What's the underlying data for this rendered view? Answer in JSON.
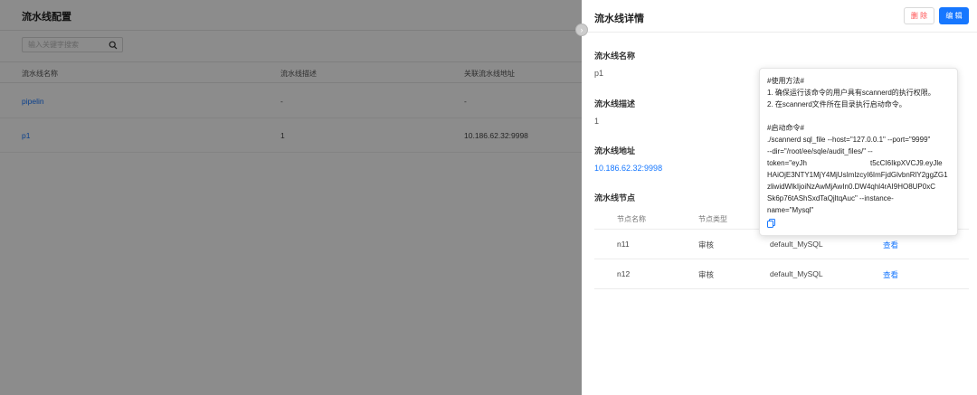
{
  "list_page": {
    "title": "流水线配置",
    "search_placeholder": "输入关键字搜索",
    "columns": [
      "流水线名称",
      "流水线描述",
      "关联流水线地址"
    ],
    "rows": [
      {
        "name": "pipelin",
        "description": "-",
        "address": "-"
      },
      {
        "name": "p1",
        "description": "1",
        "address": "10.186.62.32:9998"
      }
    ]
  },
  "drawer": {
    "title": "流水线详情",
    "delete_label": "删 除",
    "edit_label": "编 辑",
    "name_label": "流水线名称",
    "name_value": "p1",
    "desc_label": "流水线描述",
    "desc_value": "1",
    "address_label": "流水线地址",
    "address_value": "10.186.62.32:9998",
    "nodes_label": "流水线节点",
    "node_columns": [
      "节点名称",
      "节点类型"
    ],
    "nodes": [
      {
        "name": "n11",
        "type": "审核",
        "instance": "default_MySQL",
        "action": "查看"
      },
      {
        "name": "n12",
        "type": "审核",
        "instance": "default_MySQL",
        "action": "查看"
      }
    ]
  },
  "popover": {
    "usage_header": "#使用方法#",
    "usage_1": "1. 确保运行该命令的用户具有scannerd的执行权限。",
    "usage_2": "2. 在scannerd文件所在目录执行启动命令。",
    "cmd_header": "#启动命令#",
    "cmd_1": "./scannerd sql_file --host=\"127.0.0.1\" --port=\"9999\"",
    "cmd_2": "--dir=\"/root/ee/sqle/audit_files/\" --",
    "cmd_3a": "token=\"eyJh",
    "cmd_3b": "t5cCI6IkpXVCJ9.eyJle",
    "cmd_4": "HAiOjE3NTY1MjY4MjUsImlzcyI6ImFjdGlvbnRlY2ggZG1",
    "cmd_5": "zliwidWlkIjoiNzAwMjAwIn0.DW4qhl4rAI9HO8UP0xC",
    "cmd_6": "Sk6p76tAShSxdTaQjltqAuc\" --instance-",
    "cmd_7": "name=\"Mysql\""
  },
  "icons": {
    "search": "search-icon",
    "collapse": "chevron-right-icon",
    "copy": "copy-icon"
  },
  "colors": {
    "primary": "#1677ff",
    "danger": "#ff4d4f",
    "mask": "rgba(0,0,0,0.45)"
  }
}
